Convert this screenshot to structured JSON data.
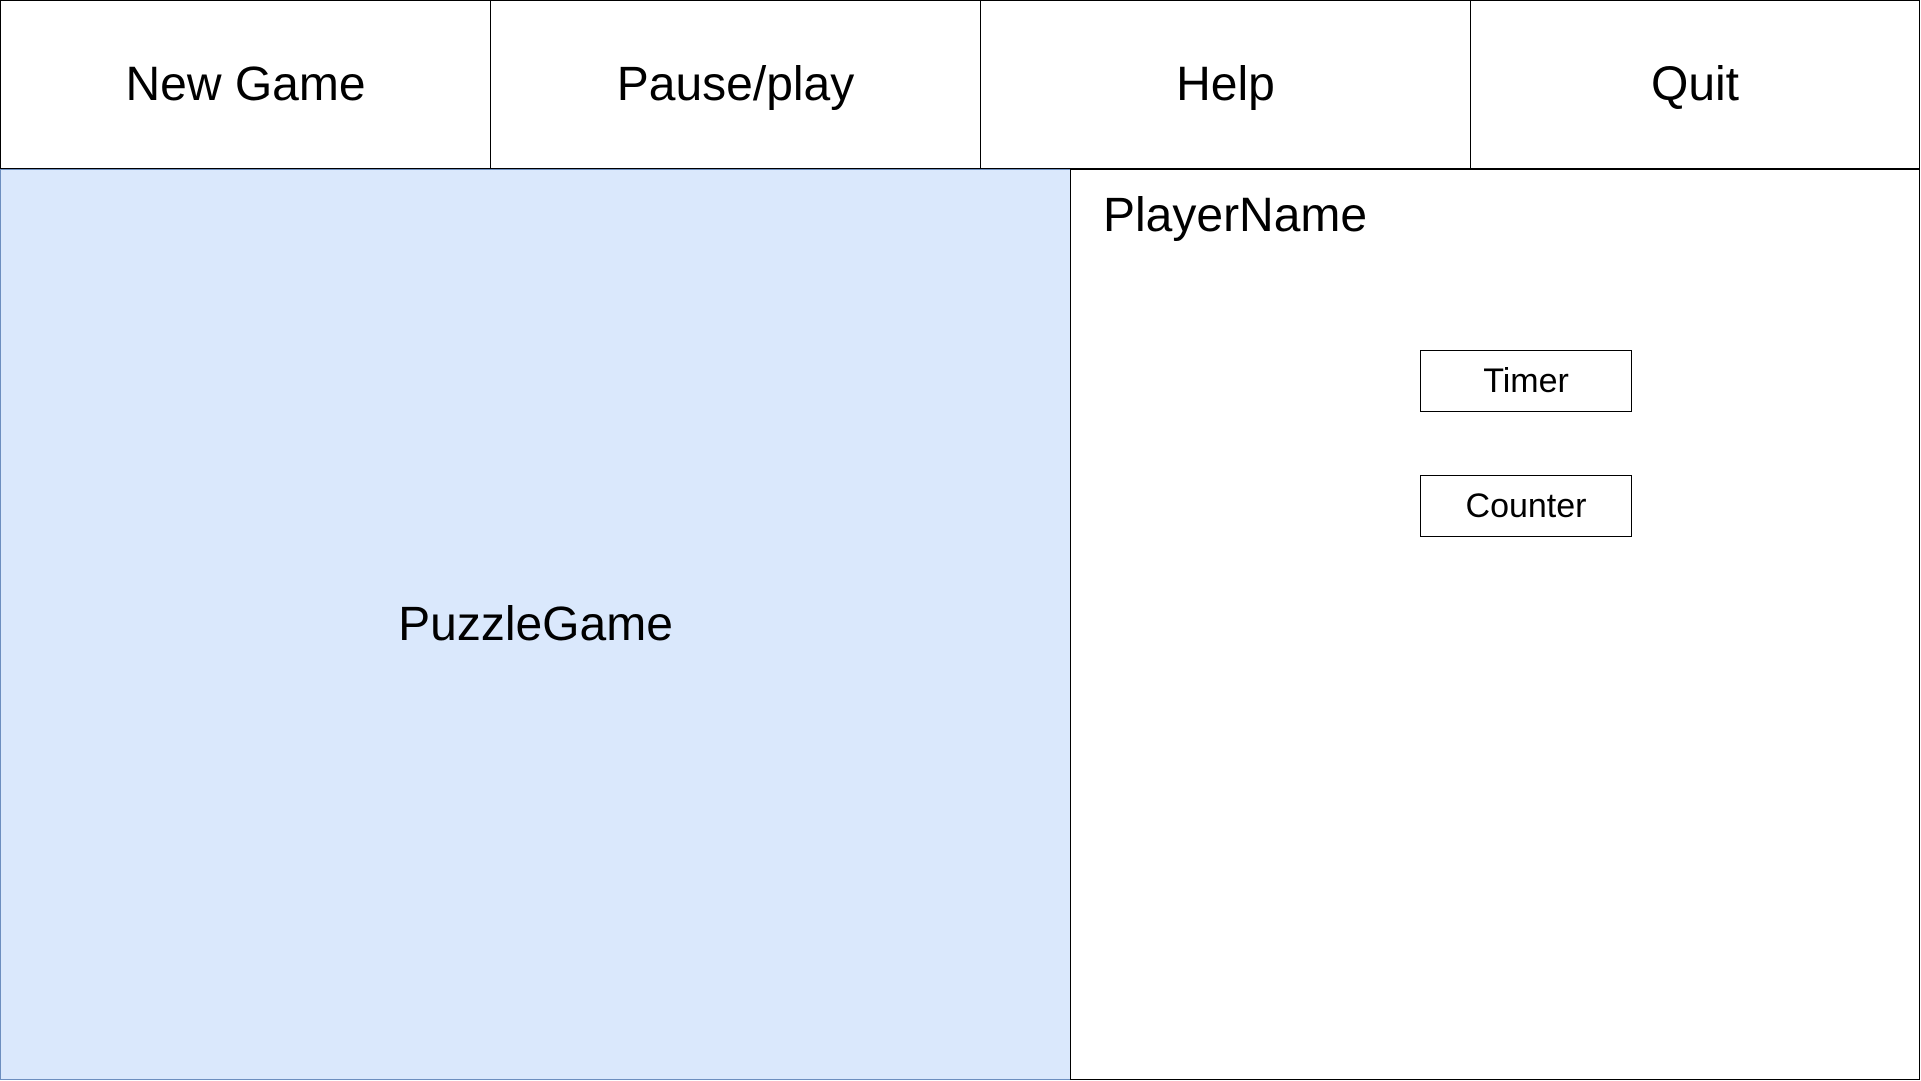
{
  "menubar": {
    "new_game_label": "New Game",
    "pause_play_label": "Pause/play",
    "help_label": "Help",
    "quit_label": "Quit"
  },
  "game_area": {
    "label": "PuzzleGame"
  },
  "side_panel": {
    "player_name": "PlayerName",
    "timer_label": "Timer",
    "counter_label": "Counter"
  },
  "colors": {
    "game_area_fill": "#dae8fc",
    "game_area_border": "#6c8ebf",
    "border": "#000000",
    "background": "#ffffff"
  }
}
